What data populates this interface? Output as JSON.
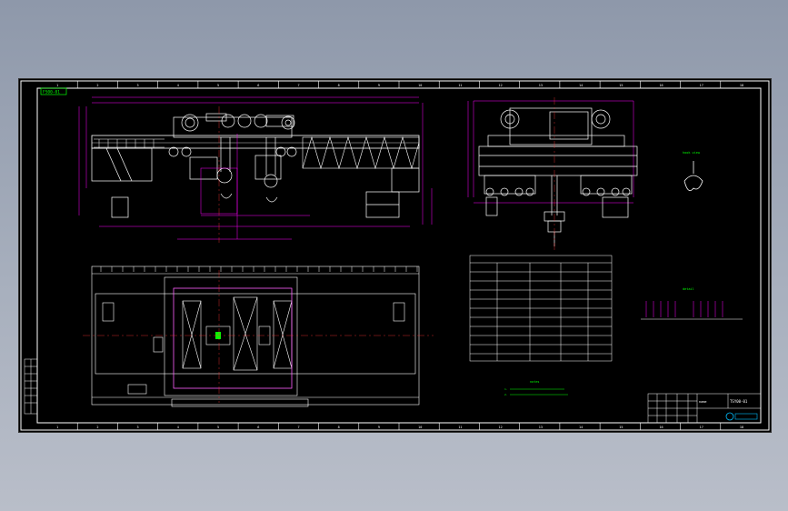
{
  "drawing": {
    "frame_code": "FS00-01",
    "border_numbers_top": [
      "1",
      "2",
      "3",
      "4",
      "5",
      "6",
      "7",
      "8",
      "9",
      "10",
      "11",
      "12",
      "13",
      "14",
      "15",
      "16",
      "17",
      "18"
    ],
    "border_numbers_bottom": [
      "1",
      "2",
      "3",
      "4",
      "5",
      "6",
      "7",
      "8",
      "9",
      "10",
      "11",
      "12",
      "13",
      "14",
      "15",
      "16",
      "17",
      "18"
    ],
    "hook_view_title": "hook view",
    "detail_title": "detail",
    "notes_title": "notes",
    "notes_lines": [
      "1.",
      "2."
    ],
    "title_block_name": "name",
    "title_block_code": "TSY00-01"
  },
  "colors": {
    "background": "#000000",
    "frame": "#ffffff",
    "structure": "#ffffff",
    "dimension": "#ff00ff",
    "centerline": "#ff3030",
    "table": "#ffffff",
    "notes": "#00ff00",
    "accent_green": "#00ff00",
    "accent_cyan": "#00bfff",
    "page_gradient_top": "#8e98aa",
    "page_gradient_bottom": "#b9bec9"
  }
}
